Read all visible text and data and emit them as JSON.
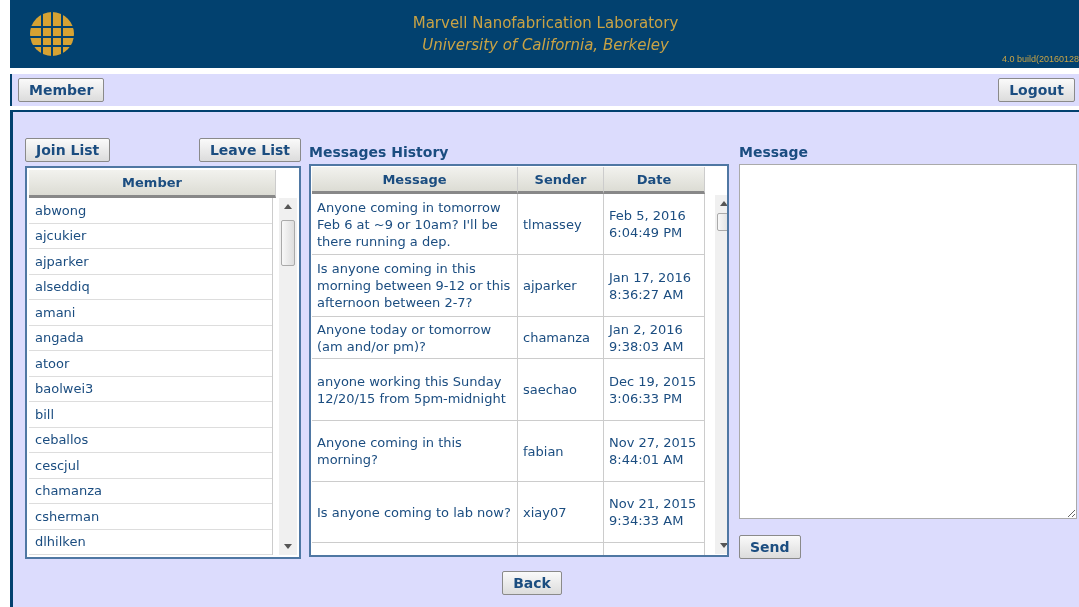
{
  "header": {
    "title": "Marvell Nanofabrication Laboratory",
    "subtitle": "University of California, Berkeley",
    "version": "4.0 build(20160128"
  },
  "nav": {
    "left_button": "Member",
    "right_button": "Logout"
  },
  "members": {
    "join_button": "Join List",
    "leave_button": "Leave List",
    "column": "Member",
    "rows": [
      "abwong",
      "ajcukier",
      "ajparker",
      "alseddiq",
      "amani",
      "angada",
      "atoor",
      "baolwei3",
      "bill",
      "ceballos",
      "cescjul",
      "chamanza",
      "csherman",
      "dlhilken"
    ]
  },
  "history": {
    "title": "Messages History",
    "columns": [
      "Message",
      "Sender",
      "Date"
    ],
    "rows": [
      {
        "message": "Anyone coming in tomorrow Feb 6 at ~9 or 10am? I'll be there running a dep.",
        "sender": "tlmassey",
        "date": "Feb 5, 2016 6:04:49 PM"
      },
      {
        "message": "Is anyone coming in this morning between 9-12 or this afternoon between 2-7?",
        "sender": "ajparker",
        "date": "Jan 17, 2016 8:36:27 AM"
      },
      {
        "message": "Anyone today or tomorrow (am and/or pm)?",
        "sender": "chamanza",
        "date": "Jan 2, 2016 9:38:03 AM"
      },
      {
        "message": "anyone working this Sunday 12/20/15 from 5pm-midnight",
        "sender": "saechao",
        "date": "Dec 19, 2015 3:06:33 PM"
      },
      {
        "message": "Anyone coming in this morning?",
        "sender": "fabian",
        "date": "Nov 27, 2015 8:44:01 AM"
      },
      {
        "message": "Is anyone coming to lab now?",
        "sender": "xiay07",
        "date": "Nov 21, 2015 9:34:33 AM"
      }
    ]
  },
  "compose": {
    "label": "Message",
    "send_button": "Send"
  },
  "back_button": "Back"
}
